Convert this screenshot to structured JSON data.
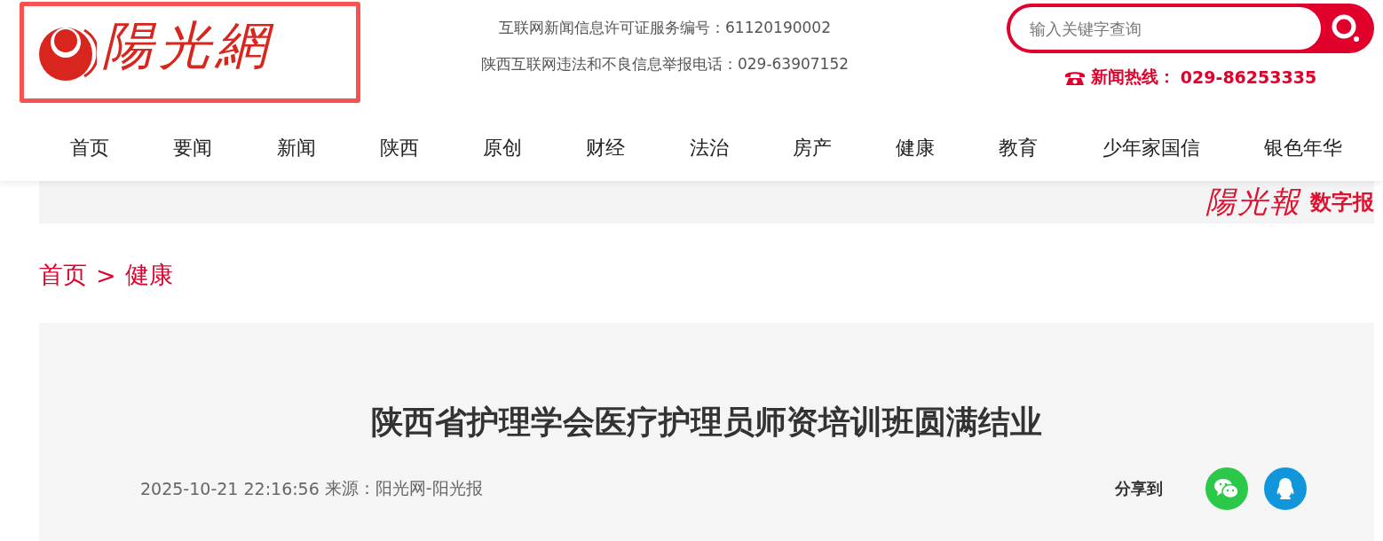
{
  "header": {
    "logo": {
      "mark": "陽光網"
    },
    "license": "互联网新闻信息许可证服务编号：61120190002",
    "report": "陕西互联网违法和不良信息举报电话：029-63907152",
    "search": {
      "placeholder": "输入关键字查询"
    },
    "hotline": {
      "label": "新闻热线：",
      "number": "029-86253335"
    }
  },
  "nav": [
    {
      "label": "首页"
    },
    {
      "label": "要闻"
    },
    {
      "label": "新闻"
    },
    {
      "label": "陕西"
    },
    {
      "label": "原创"
    },
    {
      "label": "财经"
    },
    {
      "label": "法治"
    },
    {
      "label": "房产"
    },
    {
      "label": "健康"
    },
    {
      "label": "教育"
    },
    {
      "label": "少年家国信"
    },
    {
      "label": "银色年华"
    }
  ],
  "banner": {
    "paper": "陽光報",
    "digital": "数字报"
  },
  "breadcrumb": [
    {
      "label": "首页"
    },
    {
      "label": "健康"
    }
  ],
  "breadcrumb_separator": ">",
  "article": {
    "title": "陕西省护理学会医疗护理员师资培训班圆满结业",
    "datetime": "2025-10-21 22:16:56",
    "source": "来源：阳光网-阳光报",
    "share_label": "分享到",
    "share": [
      {
        "kind": "wechat"
      },
      {
        "kind": "qq"
      }
    ]
  }
}
